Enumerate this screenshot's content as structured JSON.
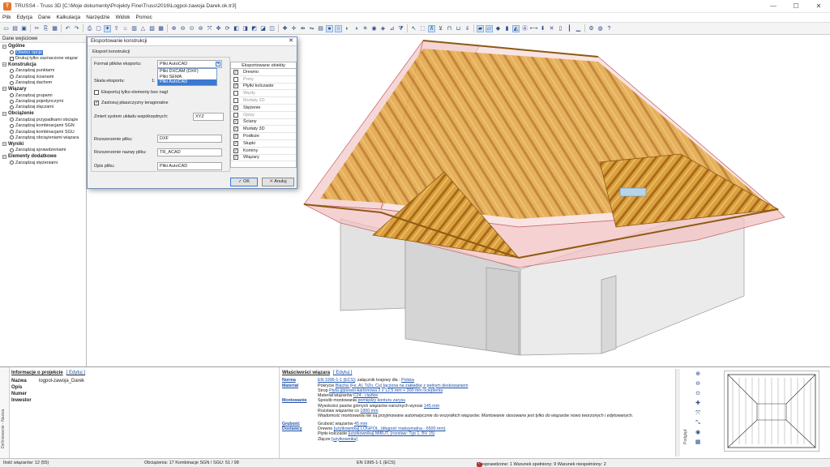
{
  "window": {
    "title": "TRUSS4 - Truss 3D [C:\\Moje dokumenty\\Projekty Fine\\Truss\\2016\\Logpol-zawoja Darek.ok.tr3]",
    "app_icon": "T",
    "minimize": "—",
    "maximize": "☐",
    "close": "✕"
  },
  "menu": [
    "Plik",
    "Edycja",
    "Dane",
    "Kalkulacja",
    "Narzędzie",
    "Widok",
    "Pomoc"
  ],
  "left_panel": {
    "header": "Dane wejściowe",
    "groups": [
      {
        "title": "Ogólne",
        "items": [
          {
            "label": "Otwórz opcje",
            "kind": "radio",
            "selected": true
          },
          {
            "label": "Drukuj tylko zaznaczone wiązar",
            "kind": "check"
          }
        ]
      },
      {
        "title": "Konstrukcja",
        "items": [
          {
            "label": "Zarządzaj punktami",
            "kind": "radio"
          },
          {
            "label": "Zarządzaj ścianami",
            "kind": "radio"
          },
          {
            "label": "Zarządzaj dachem",
            "kind": "radio"
          }
        ]
      },
      {
        "title": "Wiązary",
        "items": [
          {
            "label": "Zarządzaj grupami",
            "kind": "radio"
          },
          {
            "label": "Zarządzaj pojedynczymi",
            "kind": "radio"
          },
          {
            "label": "Zarządzaj złączami",
            "kind": "radio"
          }
        ]
      },
      {
        "title": "Obciążenie",
        "items": [
          {
            "label": "Zarządzaj przypadkami obciąże",
            "kind": "radio"
          },
          {
            "label": "Zarządzaj kombinacjami SGN",
            "kind": "radio"
          },
          {
            "label": "Zarządzaj kombinacjami SGU",
            "kind": "radio"
          },
          {
            "label": "Zarządzaj obciążeniami wiązara",
            "kind": "radio"
          }
        ]
      },
      {
        "title": "Wyniki",
        "items": [
          {
            "label": "Zarządzaj sprawdzeniami",
            "kind": "radio"
          }
        ]
      },
      {
        "title": "Elementy dodatkowe",
        "items": [
          {
            "label": "Zarządzaj stężeniami",
            "kind": "radio"
          }
        ]
      }
    ]
  },
  "dialog": {
    "title": "Eksportowanie konstrukcji",
    "close": "✕",
    "section": "Eksport konstrukcji",
    "format_label": "Format plików eksportu:",
    "format_value": "Pliki AutoCAD",
    "format_options": [
      "Pliki DXCAM (DXF)",
      "Pliki SEMA",
      "Pliki AutoCAD"
    ],
    "scale_label": "Skala eksportu:",
    "scale_value": "1:",
    "opt_only_no_nail": "Eksportuj tylko elementy bez nagl",
    "opt_taper": "Zastosuj płaszczyzny teragonalne",
    "coord_label": "Zmień system układu współrzędnych:",
    "coord_value": "XYZ",
    "ext_label": "Rozszerzenie pliku:",
    "ext_value": "DXF",
    "name_ext_label": "Rozszerzenie nazwy pliku:",
    "name_ext_value": "TR_ACAD",
    "desc_label": "Opis pliku:",
    "desc_value": "Pliki AutoCAD",
    "objects_header": "Eksportowane obiekty",
    "objects": [
      {
        "label": "Drewno",
        "checked": true
      },
      {
        "label": "Prety",
        "checked": false
      },
      {
        "label": "Płytki kolczaste",
        "checked": true
      },
      {
        "label": "Węzły",
        "checked": false
      },
      {
        "label": "Murłaty 2D",
        "checked": false
      },
      {
        "label": "Stężenie",
        "checked": true
      },
      {
        "label": "Opisy",
        "checked": false
      },
      {
        "label": "Ściany",
        "checked": true
      },
      {
        "label": "Murłaty 3D",
        "checked": true
      },
      {
        "label": "Podłoże",
        "checked": true
      },
      {
        "label": "Słupki",
        "checked": true
      },
      {
        "label": "Kominy",
        "checked": true
      },
      {
        "label": "Wiązary",
        "checked": true
      }
    ],
    "ok": "OK",
    "cancel": "Anuluj"
  },
  "project": {
    "title": "Informacje o projekcie",
    "edit": "[ Edytuj ]",
    "rows": [
      {
        "key": "Nazwa",
        "value": "logpol-zawoja_Darek"
      },
      {
        "key": "Opis",
        "value": ""
      },
      {
        "key": "Numer",
        "value": ""
      },
      {
        "key": "Inwestor",
        "value": ""
      }
    ]
  },
  "bottom_tab": "Definiowanie - Nazwa",
  "truss_props": {
    "title": "Właściwości wiązara",
    "edit": "[ Edytuj ]",
    "norma_key": "Norma",
    "norma_link": "EN 1995-1-1 (ECS)",
    "norma_text": "; załącznik krajowy dla : ",
    "norma_country": "Polska",
    "material_key": "Materiał",
    "material_line1_pre": "Pokrycie ",
    "material_line1_link": "Blacha (Fe, Al, TiZn, Cu) łączona na zakładkę z pełnym deskowaniem",
    "material_line2_pre": "Strop ",
    "material_line2_link": "Płyta gipsowo-kartonowa 2 x 12,5 mm + 300 mm ocieplenia",
    "material_line3_pre": "Materiał wiązarów ",
    "material_line3_link": "C24 , ciężkie",
    "montaz_key": "Montowanie",
    "montaz_line1_pre": "Sposób montowania ",
    "montaz_line1_link": "pomiędzy konturu zarysu",
    "montaz_line2_pre": "Wysokości pasów górnych wiązarów narożnych wynosi ",
    "montaz_line2_link": "145 mm",
    "montaz_line3_pre": "Rozstaw wiązarów co ",
    "montaz_line3_link": "1000 mm",
    "montaz_note": "Wiadomość montowania nie są przyjmowane automatycznie do wszystkich wiązarów. Montowanie stosowane jest tylko do wiązarów nowo tworzonych i edytowanych.",
    "grubosc_key": "Grubość",
    "grubosc_pre": "Grubość wiązarów ",
    "grubosc_link": "45 mm",
    "dost_key": "Dostawcy",
    "dost_line1_pre": "Drewno ",
    "dost_line1_link": "[użytkownika] LOGPOL, (długość maksymalna - 6500 mm)",
    "dost_line2_pre": "Płytki kolczaste ",
    "dost_line2_link": "[użytkownika] MiBUT, (rozstaw: Typ 1, BV 15)",
    "dost_line3_pre": "Złącze ",
    "dost_line3_link": "[użytkownika]"
  },
  "preview_label": "Podgląd",
  "status": {
    "truss_count": "Ilość wiązarów: 12 (55)",
    "loads": "Obciążenia: 17  Kombinacje SGN / SGU: 51 / 98",
    "norm": "EN 1995-1-1 (ECS)",
    "warn": "Niesprawdzone: 1  Warunek spełniony: 9  Warunek niespełniony: 2"
  }
}
